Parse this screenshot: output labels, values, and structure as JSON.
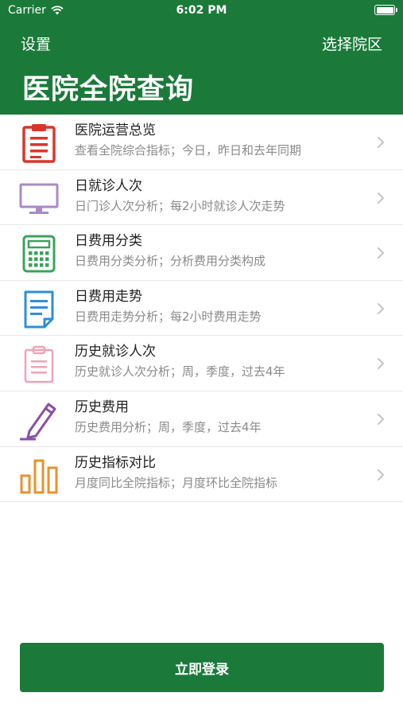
{
  "status_bar": {
    "carrier": "Carrier",
    "time": "6:02 PM",
    "battery_level": 1.0
  },
  "nav": {
    "left_label": "设置",
    "right_label": "选择院区",
    "title": "医院全院查询"
  },
  "colors": {
    "brand": "#1b7a3a"
  },
  "menu": [
    {
      "title": "医院运营总览",
      "subtitle": "查看全院综合指标；今日，昨日和去年同期",
      "icon": "clipboard-icon",
      "color": "#d9362b"
    },
    {
      "title": "日就诊人次",
      "subtitle": "日门诊人次分析；每2小时就诊人次走势",
      "icon": "monitor-icon",
      "color": "#a98bc7"
    },
    {
      "title": "日费用分类",
      "subtitle": "日费用分类分析；分析费用分类构成",
      "icon": "calculator-icon",
      "color": "#3aa35b"
    },
    {
      "title": "日费用走势",
      "subtitle": "日费用走势分析；每2小时费用走势",
      "icon": "document-icon",
      "color": "#2f8fd6"
    },
    {
      "title": "历史就诊人次",
      "subtitle": "历史就诊人次分析；周，季度，过去4年",
      "icon": "clipboard-outline-icon",
      "color": "#f0a3b8"
    },
    {
      "title": "历史费用",
      "subtitle": "历史费用分析；周，季度，过去4年",
      "icon": "pen-icon",
      "color": "#8a50a8"
    },
    {
      "title": "历史指标对比",
      "subtitle": "月度同比全院指标；月度环比全院指标",
      "icon": "bar-chart-icon",
      "color": "#e8922e"
    }
  ],
  "login_button": "立即登录"
}
